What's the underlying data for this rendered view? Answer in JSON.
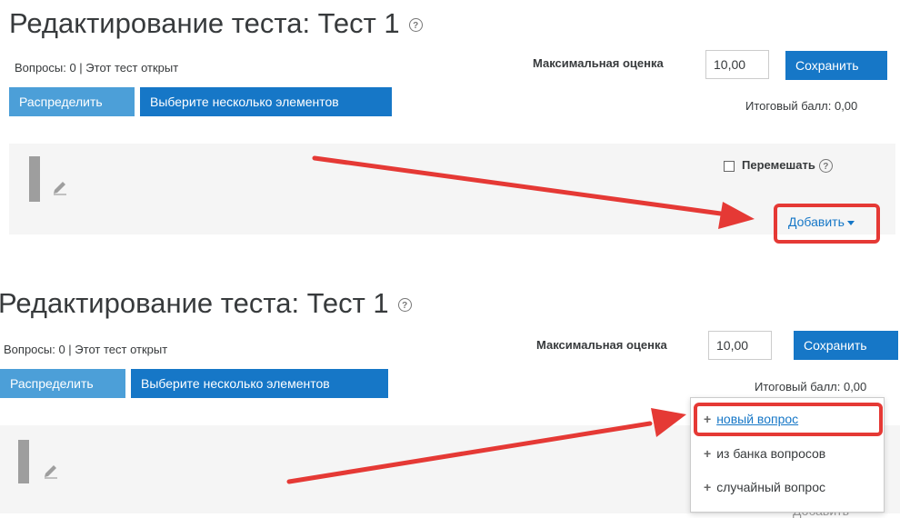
{
  "page": {
    "title": "Редактирование теста: Тест 1",
    "status": "Вопросы: 0 | Этот тест открыт",
    "distribute_label": "Распределить",
    "select_multiple_label": "Выберите несколько элементов",
    "max_grade_label": "Максимальная оценка",
    "max_grade_value": "10,00",
    "save_label": "Сохранить",
    "total_label": "Итоговый балл: 0,00",
    "shuffle_label": "Перемешать",
    "add_label": "Добавить",
    "help_glyph": "?"
  },
  "add_menu": {
    "items": [
      {
        "label": "новый вопрос",
        "icon": "plus-icon"
      },
      {
        "label": "из банка вопросов",
        "icon": "plus-icon"
      },
      {
        "label": "случайный вопрос",
        "icon": "plus-icon"
      }
    ],
    "partial_add_label": "Добавить"
  },
  "colors": {
    "primary": "#1677c7",
    "primary_light": "#4c9fd8",
    "highlight": "#e53935",
    "section_bg": "#f5f5f5"
  }
}
